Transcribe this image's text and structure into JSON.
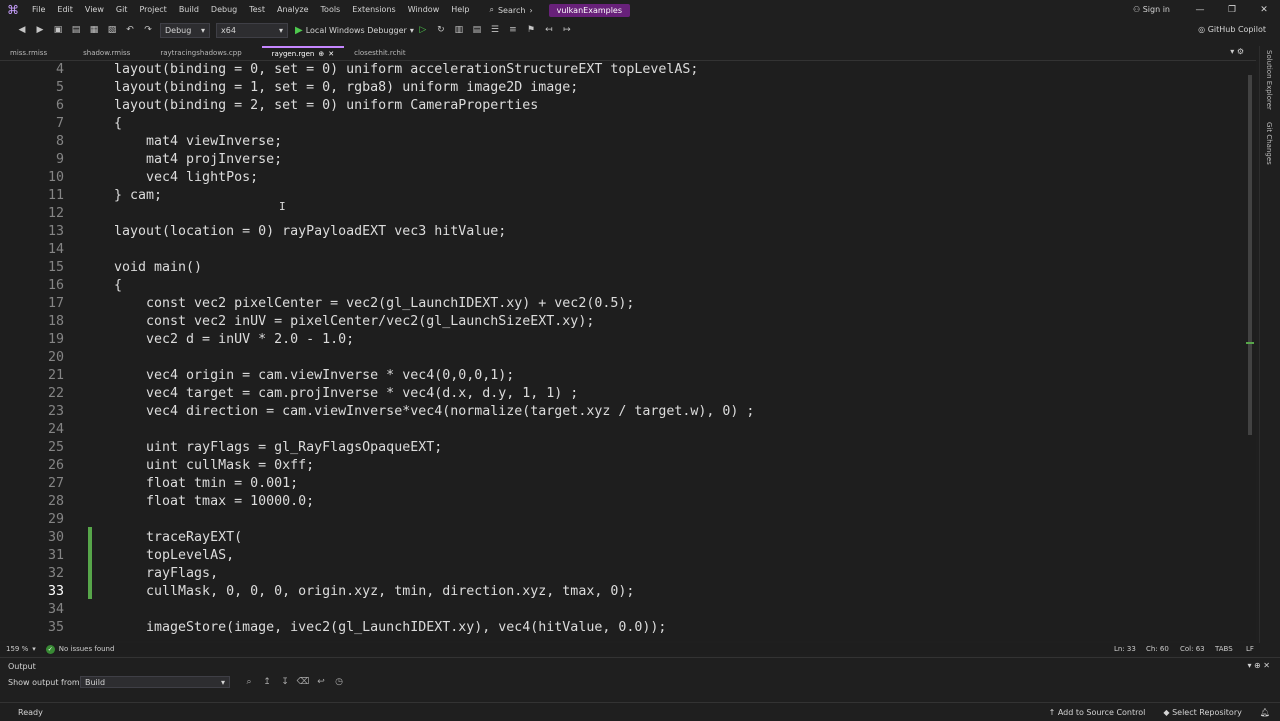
{
  "menu": {
    "items": [
      "File",
      "Edit",
      "View",
      "Git",
      "Project",
      "Build",
      "Debug",
      "Test",
      "Analyze",
      "Tools",
      "Extensions",
      "Window",
      "Help"
    ],
    "search": "Search",
    "solution": "vulkanExamples",
    "signin": "Sign in"
  },
  "toolbar": {
    "config": "Debug",
    "platform": "x64",
    "run_label": "Local Windows Debugger",
    "copilot": "GitHub Copilot"
  },
  "tabs": [
    {
      "label": "miss.rmiss"
    },
    {
      "label": "shadow.rmiss"
    },
    {
      "label": "raytracingshadows.cpp"
    },
    {
      "label": "raygen.rgen"
    },
    {
      "label": "closesthit.rchit"
    }
  ],
  "right_rail": {
    "solution_explorer": "Solution Explorer",
    "git_changes": "Git Changes"
  },
  "code": [
    {
      "n": "4",
      "text": "layout(binding = 0, set = 0) uniform accelerationStructureEXT topLevelAS;"
    },
    {
      "n": "5",
      "text": "layout(binding = 1, set = 0, rgba8) uniform image2D image;"
    },
    {
      "n": "6",
      "text": "layout(binding = 2, set = 0) uniform CameraProperties"
    },
    {
      "n": "7",
      "text": "{"
    },
    {
      "n": "8",
      "text": "    mat4 viewInverse;"
    },
    {
      "n": "9",
      "text": "    mat4 projInverse;"
    },
    {
      "n": "10",
      "text": "    vec4 lightPos;"
    },
    {
      "n": "11",
      "text": "} cam;"
    },
    {
      "n": "12",
      "text": ""
    },
    {
      "n": "13",
      "text": "layout(location = 0) rayPayloadEXT vec3 hitValue;"
    },
    {
      "n": "14",
      "text": ""
    },
    {
      "n": "15",
      "text": "void main()"
    },
    {
      "n": "16",
      "text": "{"
    },
    {
      "n": "17",
      "text": "    const vec2 pixelCenter = vec2(gl_LaunchIDEXT.xy) + vec2(0.5);"
    },
    {
      "n": "18",
      "text": "    const vec2 inUV = pixelCenter/vec2(gl_LaunchSizeEXT.xy);"
    },
    {
      "n": "19",
      "text": "    vec2 d = inUV * 2.0 - 1.0;"
    },
    {
      "n": "20",
      "text": ""
    },
    {
      "n": "21",
      "text": "    vec4 origin = cam.viewInverse * vec4(0,0,0,1);"
    },
    {
      "n": "22",
      "text": "    vec4 target = cam.projInverse * vec4(d.x, d.y, 1, 1) ;"
    },
    {
      "n": "23",
      "text": "    vec4 direction = cam.viewInverse*vec4(normalize(target.xyz / target.w), 0) ;"
    },
    {
      "n": "24",
      "text": ""
    },
    {
      "n": "25",
      "text": "    uint rayFlags = gl_RayFlagsOpaqueEXT;"
    },
    {
      "n": "26",
      "text": "    uint cullMask = 0xff;"
    },
    {
      "n": "27",
      "text": "    float tmin = 0.001;"
    },
    {
      "n": "28",
      "text": "    float tmax = 10000.0;"
    },
    {
      "n": "29",
      "text": ""
    },
    {
      "n": "30",
      "text": "    traceRayEXT("
    },
    {
      "n": "31",
      "text": "    topLevelAS,"
    },
    {
      "n": "32",
      "text": "    rayFlags,"
    },
    {
      "n": "33",
      "text": "    cullMask, 0, 0, 0, origin.xyz, tmin, direction.xyz, tmax, 0);"
    },
    {
      "n": "34",
      "text": ""
    },
    {
      "n": "35",
      "text": "    imageStore(image, ivec2(gl_LaunchIDEXT.xy), vec4(hitValue, 0.0));"
    }
  ],
  "editor_status": {
    "zoom": "159 %",
    "issues": "No issues found",
    "line": "Ln: 33",
    "ch": "Ch: 60",
    "col": "Col: 63",
    "tabs": "TABS",
    "eol": "LF"
  },
  "output": {
    "title": "Output",
    "show_from_label": "Show output from:",
    "source": "Build"
  },
  "status": {
    "ready": "Ready",
    "source_control": "Add to Source Control",
    "repo": "Select Repository"
  },
  "colors": {
    "accent": "#68217a",
    "changed": "#57a64a",
    "active_tab": "#c586ff"
  }
}
